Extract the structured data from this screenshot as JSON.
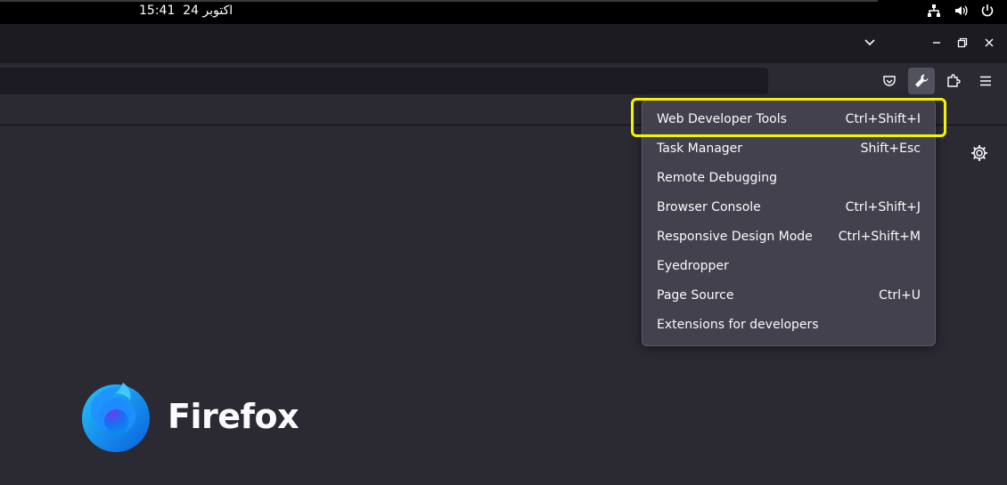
{
  "system_bar": {
    "time": "15:41",
    "date": "24 اکتوبر",
    "tray_icons": [
      "network-icon",
      "volume-icon",
      "power-icon"
    ]
  },
  "window_controls": [
    "tab-list-chevron-icon",
    "minimize-icon",
    "restore-icon",
    "close-icon"
  ],
  "toolbar": {
    "buttons": [
      "pocket-icon",
      "developer-tools-wrench-icon",
      "extensions-icon",
      "hamburger-menu-icon"
    ]
  },
  "dev_menu": {
    "items": [
      {
        "label": "Web Developer Tools",
        "shortcut": "Ctrl+Shift+I"
      },
      {
        "label": "Task Manager",
        "shortcut": "Shift+Esc"
      },
      {
        "label": "Remote Debugging",
        "shortcut": ""
      },
      {
        "label": "Browser Console",
        "shortcut": "Ctrl+Shift+J"
      },
      {
        "label": "Responsive Design Mode",
        "shortcut": "Ctrl+Shift+M"
      },
      {
        "label": "Eyedropper",
        "shortcut": ""
      },
      {
        "label": "Page Source",
        "shortcut": "Ctrl+U"
      },
      {
        "label": "Extensions for developers",
        "shortcut": ""
      }
    ],
    "highlight_color": "#f4f400"
  },
  "branding": {
    "name": "Firefox"
  },
  "colors": {
    "background": "#2b2a33",
    "tabstrip": "#1c1b22",
    "menu": "#42414d"
  }
}
